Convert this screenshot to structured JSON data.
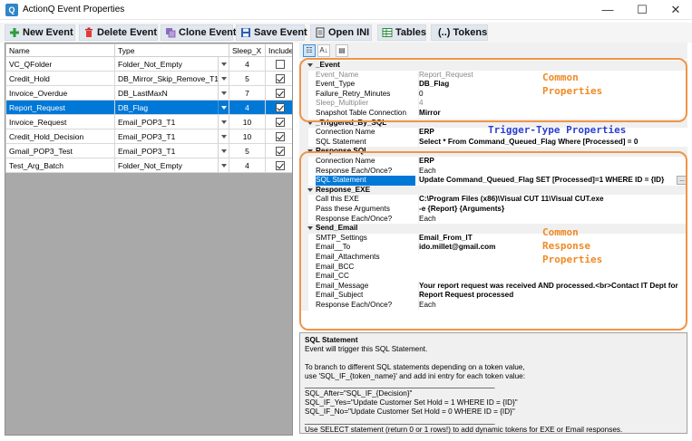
{
  "window": {
    "title": "ActionQ Event Properties",
    "controls": {
      "minimize": "—",
      "maximize": "☐",
      "close": "✕"
    }
  },
  "toolbar": {
    "new_event": "New Event",
    "delete_event": "Delete Event",
    "clone_event": "Clone Event",
    "save_event": "Save Event",
    "open_ini": "Open INI",
    "tables": "Tables",
    "tokens": "(..) Tokens"
  },
  "event_grid": {
    "columns": [
      "Name",
      "Type",
      "Sleep_X",
      "Included"
    ],
    "rows": [
      {
        "name": "VC_QFolder",
        "type": "Folder_Not_Empty",
        "sleep": "4",
        "included": false,
        "selected": false
      },
      {
        "name": "Credit_Hold",
        "type": "DB_Mirror_Skip_Remove_T1",
        "sleep": "5",
        "included": true,
        "selected": false
      },
      {
        "name": "Invoice_Overdue",
        "type": "DB_LastMaxN",
        "sleep": "7",
        "included": true,
        "selected": false
      },
      {
        "name": "Report_Request",
        "type": "DB_Flag",
        "sleep": "4",
        "included": true,
        "selected": true
      },
      {
        "name": "Invoice_Request",
        "type": "Email_POP3_T1",
        "sleep": "10",
        "included": true,
        "selected": false
      },
      {
        "name": "Credit_Hold_Decision",
        "type": "Email_POP3_T1",
        "sleep": "10",
        "included": true,
        "selected": false
      },
      {
        "name": "Gmail_POP3_Test",
        "type": "Email_POP3_T1",
        "sleep": "5",
        "included": true,
        "selected": false
      },
      {
        "name": "Test_Arg_Batch",
        "type": "Folder_Not_Empty",
        "sleep": "4",
        "included": true,
        "selected": false
      }
    ]
  },
  "property_toolbar": {
    "categorized": "☷",
    "alphabetical": "A↓",
    "pages": "▤"
  },
  "properties": [
    {
      "kind": "cat",
      "name": "_Event"
    },
    {
      "kind": "ro",
      "name": "Event_Name",
      "value": "Report_Request"
    },
    {
      "kind": "prop",
      "name": "Event_Type",
      "value": "DB_Flag"
    },
    {
      "kind": "norm",
      "name": "Failure_Retry_Minutes",
      "value": "0"
    },
    {
      "kind": "ro",
      "name": "Sleep_Multiplier",
      "value": "4"
    },
    {
      "kind": "prop",
      "name": "Snapshot Table Connection",
      "value": "Mirror"
    },
    {
      "kind": "cat",
      "name": "_Triggered_By_SQL"
    },
    {
      "kind": "prop",
      "name": "Connection Name",
      "value": "ERP"
    },
    {
      "kind": "prop",
      "name": "SQL Statement",
      "value": "Select * From Command_Queued_Flag Where [Processed] = 0"
    },
    {
      "kind": "cat",
      "name": "Response SQL"
    },
    {
      "kind": "prop",
      "name": "Connection Name",
      "value": "ERP"
    },
    {
      "kind": "norm",
      "name": "Response Each/Once?",
      "value": "Each"
    },
    {
      "kind": "sel",
      "name": "SQL Statement",
      "value": "Update Command_Queued_Flag SET [Processed]=1 WHERE ID = {ID}"
    },
    {
      "kind": "cat",
      "name": "Response_EXE"
    },
    {
      "kind": "prop",
      "name": "Call this EXE",
      "value": "C:\\Program Files (x86)\\Visual CUT 11\\Visual CUT.exe"
    },
    {
      "kind": "prop",
      "name": "Pass these Arguments",
      "value": "-e {Report} {Arguments}"
    },
    {
      "kind": "norm",
      "name": "Response Each/Once?",
      "value": "Each"
    },
    {
      "kind": "cat",
      "name": "Send_Email"
    },
    {
      "kind": "prop",
      "name": " SMTP_Settings",
      "value": "Email_From_IT"
    },
    {
      "kind": "prop",
      "name": "Email__To",
      "value": "ido.millet@gmail.com"
    },
    {
      "kind": "prop",
      "name": "Email_Attachments",
      "value": ""
    },
    {
      "kind": "prop",
      "name": "Email_BCC",
      "value": ""
    },
    {
      "kind": "prop",
      "name": "Email_CC",
      "value": ""
    },
    {
      "kind": "prop",
      "name": "Email_Message",
      "value": "Your report request was received AND processed.<br>Contact IT Dept for"
    },
    {
      "kind": "prop",
      "name": "Email_Subject",
      "value": "Report Request processed"
    },
    {
      "kind": "norm",
      "name": "Response Each/Once?",
      "value": "Each"
    }
  ],
  "annotations": {
    "common_properties": "Common\nProperties",
    "trigger_type": "Trigger-Type Properties",
    "common_response": "Common\nResponse\nProperties",
    "color_orange": "#f08a24",
    "color_blue": "#2b3fd1"
  },
  "description": {
    "title": "SQL Statement",
    "lines": [
      "Event will trigger this SQL Statement.",
      "",
      "To branch to different SQL statements depending on a token value,",
      "use 'SQL_IF_{token_name}' and add ini entry for each token value:",
      "______________________________________________",
      "SQL_After=\"SQL_IF_{Decision}\"",
      "SQL_IF_Yes=\"Update Customer Set Hold = 1 WHERE ID = {ID}\"",
      "SQL_IF_No=\"Update Customer Set Hold = 0 WHERE ID = {ID}\"",
      "______________________________________________",
      "Use SELECT statement (return 0 or 1 rows!) to add dynamic tokens for EXE or Email responses."
    ]
  }
}
